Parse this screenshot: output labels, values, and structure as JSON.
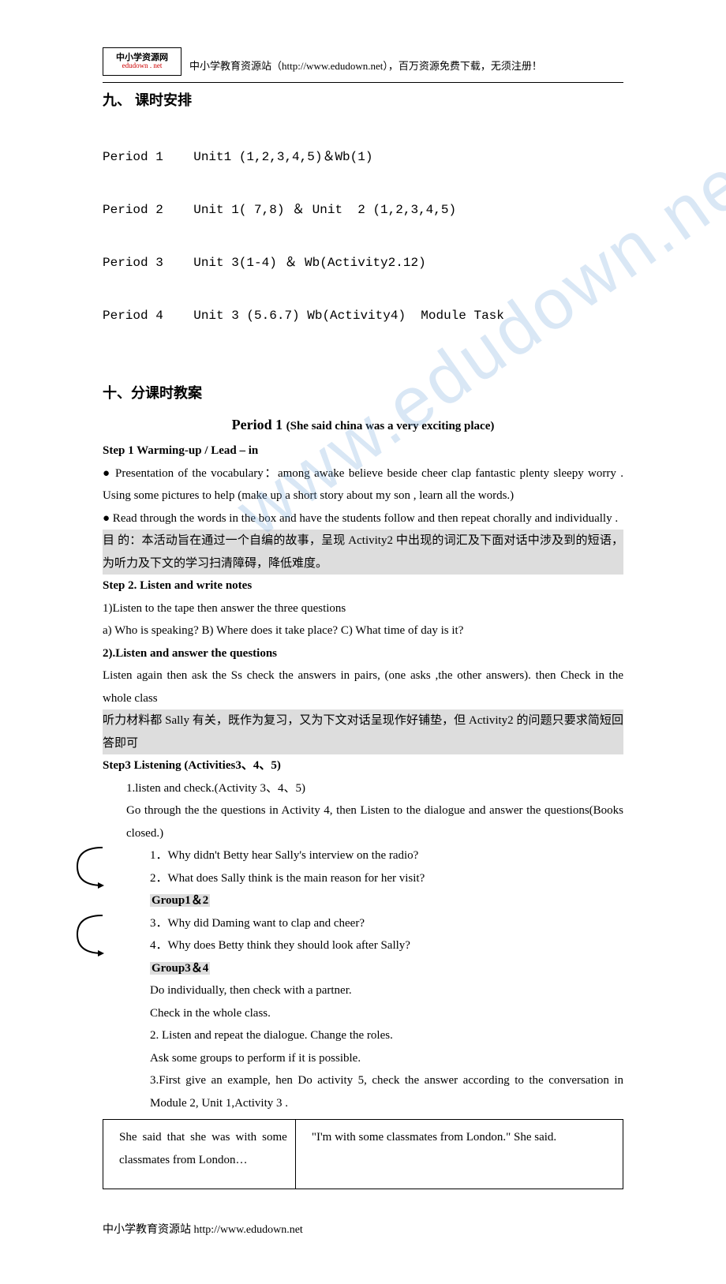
{
  "header": {
    "logo_top": "中小学资源网",
    "logo_bottom": "edudown . net",
    "text": "中小学教育资源站（http://www.edudown.net），百万资源免费下载，无须注册！"
  },
  "watermark": "www.edudown.net",
  "section9": {
    "title": "九、   课时安排",
    "rows": [
      "Period 1    Unit1 (1,2,3,4,5)＆Wb(1)",
      "Period 2    Unit 1( 7,8) ＆ Unit  2 (1,2,3,4,5)",
      "Period 3    Unit 3(1-4) ＆ Wb(Activity2.12)",
      "Period 4    Unit 3 (5.6.7) Wb(Activity4)  Module Task"
    ]
  },
  "section10": {
    "title": "十、分课时教案"
  },
  "period1": {
    "number": "Period 1",
    "subtitle": "(She said china was a very exciting place)"
  },
  "step1": {
    "heading": "Step 1 Warming-up / Lead – in",
    "p1": "● Presentation of the vocabulary：among   awake   believe   beside   cheer   clap   fantastic   plenty   sleepy    worry . Using some pictures to help (make up a short story about my son , learn all the words.)",
    "p2": "    ● Read through the words in the box and have the students follow and then repeat chorally and individually .",
    "hl": "目 的：本活动旨在通过一个自编的故事，呈现 Activity2 中出现的词汇及下面对话中涉及到的短语，为听力及下文的学习扫清障碍，降低难度。"
  },
  "step2": {
    "heading": "Step 2. Listen and write notes",
    "l1": "1)Listen to the tape then answer the three questions",
    "l2": "a) Who is speaking?      B) Where does it take place?        C) What time of day is it?",
    "l3": "2).Listen and answer the questions",
    "l4": "Listen again then ask the Ss check the answers in pairs, (one asks ,the other answers). then Check in the whole class",
    "hl": "听力材料都 Sally 有关，既作为复习，又为下文对话呈现作好铺垫，但 Activity2 的问题只要求简短回答即可"
  },
  "step3": {
    "heading": "Step3    Listening (Activities3、4、5)",
    "l1": "1.listen and check.(Activity 3、4、5)",
    "l2": "Go through the the questions in Activity 4, then Listen to the dialogue and answer the questions(Books closed.)",
    "q1": "1．Why didn't Betty hear Sally's interview on the radio?",
    "q2": "2．What does Sally think is the main reason for her visit?",
    "g12": "Group1＆2",
    "q3": "3．Why did Daming want to clap and cheer?",
    "q4": "4．Why does Betty think they should look after Sally?",
    "g34": "Group3＆4",
    "l3": "Do individually, then check with a partner.",
    "l4": "Check in the whole class.",
    "l5": "2. Listen and repeat the dialogue. Change the roles.",
    "l6": "Ask some groups to perform if it is possible.",
    "l7": "3.First give an example, hen Do activity 5, check the answer according to the conversation in Module 2, Unit 1,Activity 3 .",
    "table": {
      "left": "She  said  that  she  was  with  some classmates from London…",
      "right": "\"I'm  with  some  classmates  from  London.\"      She said."
    }
  },
  "footer": "中小学教育资源站  http://www.edudown.net"
}
